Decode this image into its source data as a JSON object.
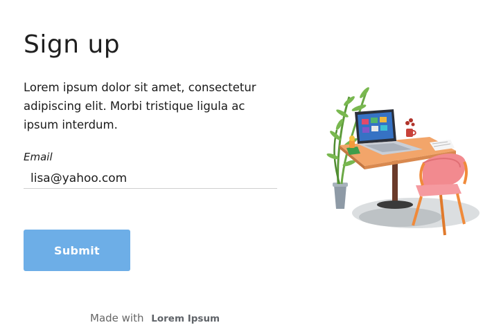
{
  "form": {
    "title": "Sign up",
    "description": "Lorem ipsum dolor sit amet, consectetur adipiscing elit. Morbi tristique ligula ac ipsum interdum.",
    "email_label": "Email",
    "email_value": "lisa@yahoo.com",
    "submit_label": "Submit"
  },
  "footer": {
    "made_with": "Made with",
    "brand": "Lorem Ipsum"
  },
  "colors": {
    "submit_button": "#6daee7",
    "input_underline": "#cfcfcf",
    "footer_text": "#666666"
  },
  "illustration": {
    "icon": "workspace-desk-illustration"
  }
}
